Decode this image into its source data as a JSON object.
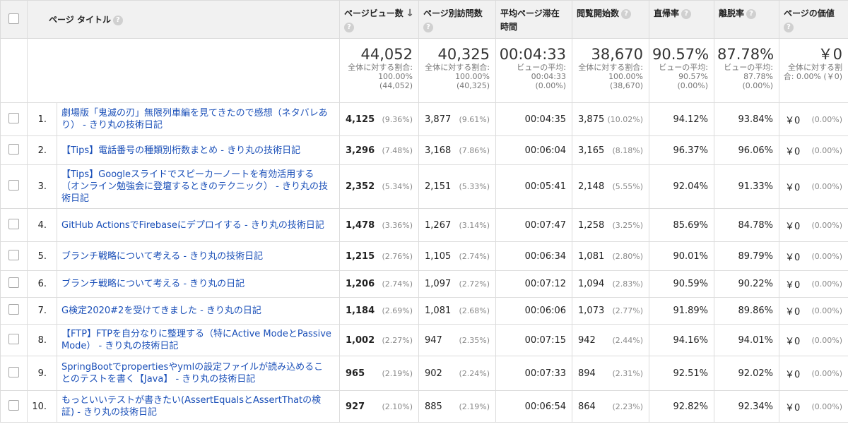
{
  "headers": {
    "page_title": "ページ タイトル",
    "pageviews": "ページビュー数",
    "unique_pageviews": "ページ別訪問数",
    "avg_time": "平均ページ滞在時間",
    "entrances": "閲覧開始数",
    "bounce_rate": "直帰率",
    "exit_rate": "離脱率",
    "page_value": "ページの価値"
  },
  "totals": {
    "pageviews": {
      "value": "44,052",
      "sub": "全体に対する割合: 100.00% (44,052)"
    },
    "unique_pageviews": {
      "value": "40,325",
      "sub": "全体に対する割合: 100.00% (40,325)"
    },
    "avg_time": {
      "value": "00:04:33",
      "sub": "ビューの平均: 00:04:33 (0.00%)"
    },
    "entrances": {
      "value": "38,670",
      "sub": "全体に対する割合: 100.00% (38,670)"
    },
    "bounce_rate": {
      "value": "90.57%",
      "sub": "ビューの平均: 90.57% (0.00%)"
    },
    "exit_rate": {
      "value": "87.78%",
      "sub": "ビューの平均: 87.78% (0.00%)"
    },
    "page_value": {
      "value": "￥0",
      "sub": "全体に対する割合: 0.00% (￥0)"
    }
  },
  "rows": [
    {
      "idx": "1.",
      "title": "劇場版「鬼滅の刃」無限列車編を見てきたので感想（ネタバレあり） - きり丸の技術日記",
      "pv": "4,125",
      "pv_pct": "(9.36%)",
      "upv": "3,877",
      "upv_pct": "(9.61%)",
      "time": "00:04:35",
      "ent": "3,875",
      "ent_pct": "(10.02%)",
      "bounce": "94.12%",
      "exit": "93.84%",
      "val": "￥0",
      "val_pct": "(0.00%)"
    },
    {
      "idx": "2.",
      "title": "【Tips】電話番号の種類別桁数まとめ - きり丸の技術日記",
      "pv": "3,296",
      "pv_pct": "(7.48%)",
      "upv": "3,168",
      "upv_pct": "(7.86%)",
      "time": "00:06:04",
      "ent": "3,165",
      "ent_pct": "(8.18%)",
      "bounce": "96.37%",
      "exit": "96.06%",
      "val": "￥0",
      "val_pct": "(0.00%)"
    },
    {
      "idx": "3.",
      "title": "【Tips】Googleスライドでスピーカーノートを有効活用する（オンライン勉強会に登壇するときのテクニック） - きり丸の技術日記",
      "pv": "2,352",
      "pv_pct": "(5.34%)",
      "upv": "2,151",
      "upv_pct": "(5.33%)",
      "time": "00:05:41",
      "ent": "2,148",
      "ent_pct": "(5.55%)",
      "bounce": "92.04%",
      "exit": "91.33%",
      "val": "￥0",
      "val_pct": "(0.00%)"
    },
    {
      "idx": "4.",
      "title": "GitHub ActionsでFirebaseにデプロイする - きり丸の技術日記",
      "pv": "1,478",
      "pv_pct": "(3.36%)",
      "upv": "1,267",
      "upv_pct": "(3.14%)",
      "time": "00:07:47",
      "ent": "1,258",
      "ent_pct": "(3.25%)",
      "bounce": "85.69%",
      "exit": "84.78%",
      "val": "￥0",
      "val_pct": "(0.00%)"
    },
    {
      "idx": "5.",
      "title": "ブランチ戦略について考える - きり丸の技術日記",
      "pv": "1,215",
      "pv_pct": "(2.76%)",
      "upv": "1,105",
      "upv_pct": "(2.74%)",
      "time": "00:06:34",
      "ent": "1,081",
      "ent_pct": "(2.80%)",
      "bounce": "90.01%",
      "exit": "89.79%",
      "val": "￥0",
      "val_pct": "(0.00%)"
    },
    {
      "idx": "6.",
      "title": "ブランチ戦略について考える - きり丸の日記",
      "pv": "1,206",
      "pv_pct": "(2.74%)",
      "upv": "1,097",
      "upv_pct": "(2.72%)",
      "time": "00:07:12",
      "ent": "1,094",
      "ent_pct": "(2.83%)",
      "bounce": "90.59%",
      "exit": "90.22%",
      "val": "￥0",
      "val_pct": "(0.00%)"
    },
    {
      "idx": "7.",
      "title": "G検定2020#2を受けてきました - きり丸の日記",
      "pv": "1,184",
      "pv_pct": "(2.69%)",
      "upv": "1,081",
      "upv_pct": "(2.68%)",
      "time": "00:06:06",
      "ent": "1,073",
      "ent_pct": "(2.77%)",
      "bounce": "91.89%",
      "exit": "89.86%",
      "val": "￥0",
      "val_pct": "(0.00%)"
    },
    {
      "idx": "8.",
      "title": "【FTP】FTPを自分なりに整理する（特にActive ModeとPassive Mode） - きり丸の技術日記",
      "pv": "1,002",
      "pv_pct": "(2.27%)",
      "upv": "947",
      "upv_pct": "(2.35%)",
      "time": "00:07:15",
      "ent": "942",
      "ent_pct": "(2.44%)",
      "bounce": "94.16%",
      "exit": "94.01%",
      "val": "￥0",
      "val_pct": "(0.00%)"
    },
    {
      "idx": "9.",
      "title": "SpringBootでpropertiesやymlの設定ファイルが読み込めることのテストを書く【Java】 - きり丸の技術日記",
      "pv": "965",
      "pv_pct": "(2.19%)",
      "upv": "902",
      "upv_pct": "(2.24%)",
      "time": "00:07:33",
      "ent": "894",
      "ent_pct": "(2.31%)",
      "bounce": "92.51%",
      "exit": "92.02%",
      "val": "￥0",
      "val_pct": "(0.00%)"
    },
    {
      "idx": "10.",
      "title": "もっといいテストが書きたい(AssertEqualsとAssertThatの検証) - きり丸の技術日記",
      "pv": "927",
      "pv_pct": "(2.10%)",
      "upv": "885",
      "upv_pct": "(2.19%)",
      "time": "00:06:54",
      "ent": "864",
      "ent_pct": "(2.23%)",
      "bounce": "92.82%",
      "exit": "92.34%",
      "val": "￥0",
      "val_pct": "(0.00%)"
    }
  ]
}
